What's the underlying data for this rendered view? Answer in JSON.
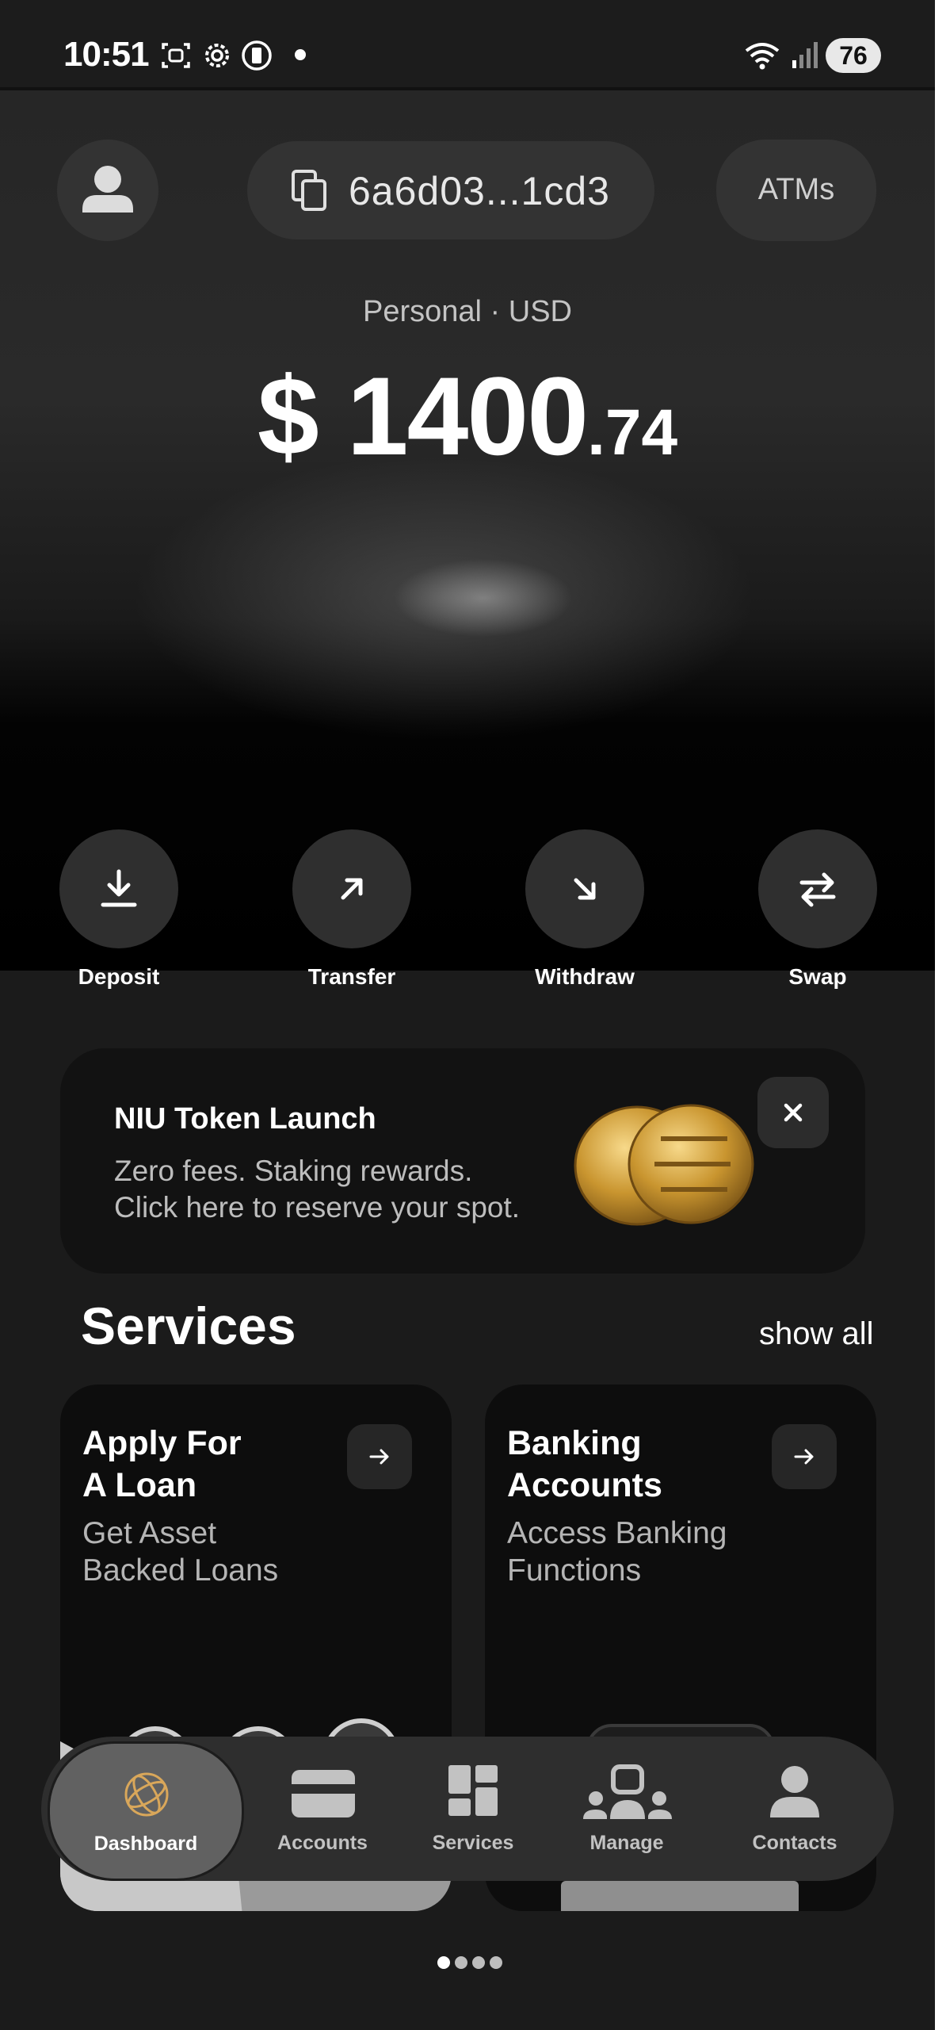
{
  "status_bar": {
    "time": "10:51",
    "battery": "76"
  },
  "header": {
    "wallet_address": "6a6d03...1cd3",
    "atms_label": "ATMs"
  },
  "account": {
    "type_label": "Personal · USD",
    "currency_symbol": "$",
    "balance_whole": "1400",
    "balance_cents": ".74"
  },
  "actions": [
    {
      "label": "Deposit",
      "icon": "deposit-icon"
    },
    {
      "label": "Transfer",
      "icon": "arrow-up-right-icon"
    },
    {
      "label": "Withdraw",
      "icon": "arrow-down-right-icon"
    },
    {
      "label": "Swap",
      "icon": "swap-icon"
    }
  ],
  "promo": {
    "title": "NIU Token Launch",
    "line1": "Zero fees. Staking rewards.",
    "line2": "Click here to reserve your spot.",
    "coin_color": "#c9952f"
  },
  "services": {
    "title": "Services",
    "show_all": "show all",
    "cards": [
      {
        "title_line1": "Apply For",
        "title_line2": "A Loan",
        "desc_line1": "Get Asset",
        "desc_line2": "Backed Loans"
      },
      {
        "title_line1": "Banking",
        "title_line2": "Accounts",
        "desc_line1": "Access Banking",
        "desc_line2": "Functions"
      }
    ]
  },
  "nav": {
    "items": [
      {
        "label": "Dashboard",
        "icon": "globe-icon",
        "active": true
      },
      {
        "label": "Accounts",
        "icon": "card-icon"
      },
      {
        "label": "Services",
        "icon": "grid-icon"
      },
      {
        "label": "Manage",
        "icon": "team-icon"
      },
      {
        "label": "Contacts",
        "icon": "person-icon"
      }
    ],
    "accent": "#d9a75a"
  },
  "pager": {
    "count": 4,
    "active_index": 0
  }
}
